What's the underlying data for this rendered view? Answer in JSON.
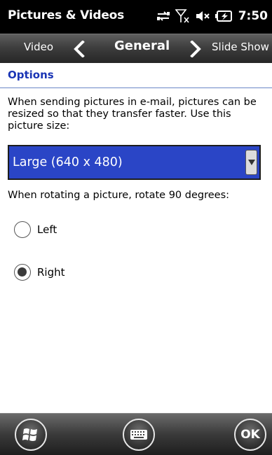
{
  "status_bar": {
    "app_title": "Pictures & Videos",
    "icons": [
      "data-sync-icon",
      "no-signal-icon",
      "speaker-muted-icon",
      "battery-charging-icon"
    ],
    "clock": "7:50"
  },
  "tabs": {
    "previous": "Video",
    "current": "General",
    "next": "Slide Show"
  },
  "options": {
    "section_title": "Options",
    "description": "When sending pictures in e-mail, pictures can be resized so that they transfer faster. Use this picture size:",
    "picture_size": {
      "selected": "Large (640 x 480)"
    },
    "rotate_label": "When rotating a picture, rotate 90 degrees:",
    "rotate_options": [
      {
        "label": "Left",
        "checked": false
      },
      {
        "label": "Right",
        "checked": true
      }
    ]
  },
  "bottom_bar": {
    "start_icon": "windows-start-icon",
    "keyboard_icon": "keyboard-icon",
    "ok_label": "OK"
  },
  "colors": {
    "accent": "#1a35b5",
    "selection": "#2a45c6"
  }
}
